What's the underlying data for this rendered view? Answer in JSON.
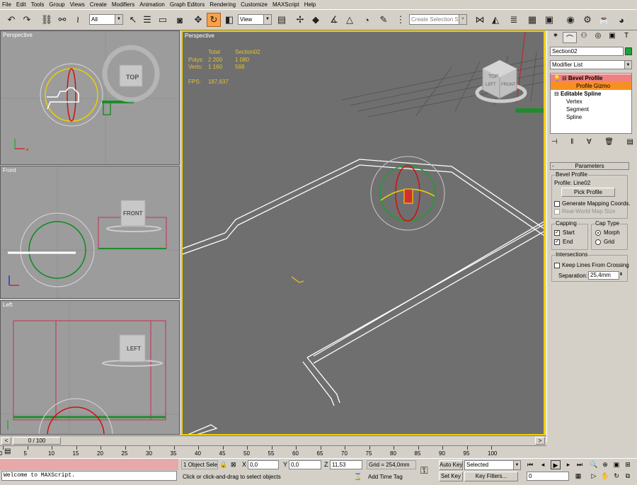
{
  "menu": [
    "File",
    "Edit",
    "Tools",
    "Group",
    "Views",
    "Create",
    "Modifiers",
    "Animation",
    "Graph Editors",
    "Rendering",
    "Customize",
    "MAXScript",
    "Help"
  ],
  "toolbar": {
    "selection_filter": "All",
    "ref_coord": "View",
    "named_selection_placeholder": "Create Selection Set",
    "icons": [
      "undo-icon",
      "redo-icon",
      "link-icon",
      "unlink-icon",
      "bind-space-warp-icon",
      "select-icon",
      "select-by-name-icon",
      "rect-region-icon",
      "window-crossing-icon",
      "move-icon",
      "rotate-icon",
      "scale-icon",
      "pivot-icon",
      "mirror-icon",
      "align-icon",
      "angle-snap-icon",
      "percent-snap-icon",
      "spinner-snap-icon",
      "edit-named-sel-icon",
      "layer-icon",
      "curve-editor-icon",
      "schematic-icon",
      "material-editor-icon",
      "render-setup-icon",
      "quick-render-icon",
      "active-shade-icon"
    ]
  },
  "viewports": {
    "top_left": {
      "label": "Perspective"
    },
    "front": {
      "label": "Front",
      "cube": "FRONT"
    },
    "left": {
      "label": "Left",
      "cube": "LEFT"
    },
    "top_left_cube": "TOP",
    "main": {
      "label": "Perspective",
      "stats_header": [
        "Total",
        "Section02"
      ],
      "polys": {
        "label": "Polys:",
        "total": "2 200",
        "sel": "1 080"
      },
      "verts": {
        "label": "Verts:",
        "total": "1 160",
        "sel": "569"
      },
      "fps": {
        "label": "FPS:",
        "value": "187,637"
      },
      "cube_top": "TOP",
      "cube_left": "LEFT",
      "cube_front": "FRONT"
    }
  },
  "command_panel": {
    "tabs": [
      "create-icon",
      "modify-icon",
      "hierarchy-icon",
      "motion-icon",
      "display-icon",
      "utilities-icon"
    ],
    "object_name": "Section02",
    "object_color": "#1aa33a",
    "modifier_list": "Modifier List",
    "stack": [
      {
        "label": "Bevel Profile",
        "level": 0,
        "state": "modifier"
      },
      {
        "label": "Profile Gizmo",
        "level": 1,
        "state": "subsel"
      },
      {
        "label": "Editable Spline",
        "level": 0,
        "state": "base"
      },
      {
        "label": "Vertex",
        "level": 1,
        "state": "normal"
      },
      {
        "label": "Segment",
        "level": 1,
        "state": "normal"
      },
      {
        "label": "Spline",
        "level": 1,
        "state": "normal"
      }
    ],
    "parameters": {
      "rollout": "Parameters",
      "rollout_toggle": "-",
      "group_bevel": "Bevel Profile",
      "profile_label": "Profile: Line02",
      "pick_profile": "Pick Profile",
      "generate_mapping": "Generate Mapping Coords.",
      "real_world": "Real-World Map Size",
      "group_capping": "Capping",
      "cap_start": "Start",
      "cap_end": "End",
      "group_captype": "Cap Type",
      "morph": "Morph",
      "grid": "Grid",
      "group_intersections": "Intersections",
      "keep_lines": "Keep Lines From Crossing",
      "separation_label": "Separation:",
      "separation_value": "25,4mm"
    }
  },
  "timeline": {
    "frame": "0 / 100",
    "ticks": [
      "0",
      "5",
      "10",
      "15",
      "20",
      "25",
      "30",
      "35",
      "40",
      "45",
      "50",
      "55",
      "60",
      "65",
      "70",
      "75",
      "80",
      "85",
      "90",
      "95",
      "100"
    ]
  },
  "status": {
    "maxscript": "Welcome to MAXScript.",
    "selection": "1 Object Sele",
    "x_label": "X",
    "x": "0,0",
    "y_label": "Y",
    "y": "0,0",
    "z_label": "Z",
    "z": "11,53",
    "grid": "Grid = 254,0mm",
    "prompt": "Click or click-and-drag to select objects",
    "add_time_tag": "Add Time Tag",
    "auto_key": "Auto Key",
    "set_key": "Set Key",
    "key_mode": "Selected",
    "key_filters": "Key Filters...",
    "current_frame": "0"
  }
}
